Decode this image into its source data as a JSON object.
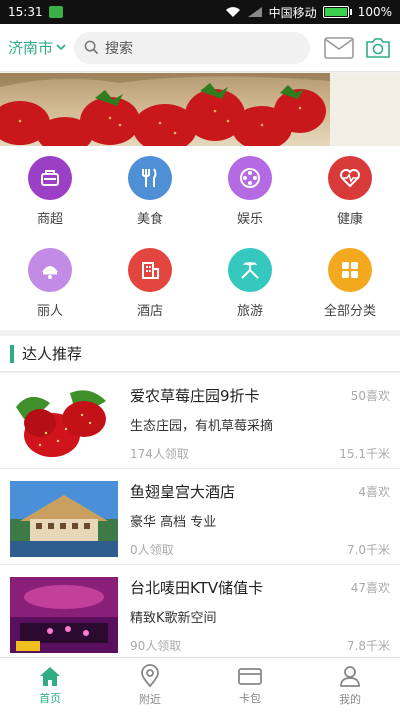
{
  "status_bar": {
    "time": "15:31",
    "carrier": "中国移动",
    "battery": "100%"
  },
  "header": {
    "city": "济南市",
    "search_placeholder": "搜索"
  },
  "categories": [
    {
      "label": "商超",
      "color": "#9b3fc7",
      "icon": "supermarket-icon"
    },
    {
      "label": "美食",
      "color": "#4f8fd6",
      "icon": "food-icon"
    },
    {
      "label": "娱乐",
      "color": "#b36ae2",
      "icon": "entertainment-icon"
    },
    {
      "label": "健康",
      "color": "#d83a3a",
      "icon": "health-icon"
    },
    {
      "label": "丽人",
      "color": "#c28be6",
      "icon": "beauty-icon"
    },
    {
      "label": "酒店",
      "color": "#e2463e",
      "icon": "hotel-icon"
    },
    {
      "label": "旅游",
      "color": "#35c8bf",
      "icon": "travel-icon"
    },
    {
      "label": "全部分类",
      "color": "#f3a91d",
      "icon": "all-categories-icon"
    }
  ],
  "section": {
    "title": "达人推荐"
  },
  "list": [
    {
      "title": "爱农草莓庄园9折卡",
      "likes": "50喜欢",
      "desc": "生态庄园，有机草莓采摘",
      "claimed": "174人领取",
      "distance": "15.1千米"
    },
    {
      "title": "鱼翅皇宫大酒店",
      "likes": "4喜欢",
      "desc": "豪华 高档 专业",
      "claimed": "0人领取",
      "distance": "7.0千米"
    },
    {
      "title": "台北唛田KTV储值卡",
      "likes": "47喜欢",
      "desc": "精致K歌新空间",
      "claimed": "90人领取",
      "distance": "7.8千米"
    }
  ],
  "nav": [
    {
      "label": "首页",
      "icon": "home-icon",
      "active": true
    },
    {
      "label": "附近",
      "icon": "location-pin-icon",
      "active": false
    },
    {
      "label": "卡包",
      "icon": "card-icon",
      "active": false
    },
    {
      "label": "我的",
      "icon": "user-icon",
      "active": false
    }
  ],
  "colors": {
    "accent": "#2fae86"
  }
}
